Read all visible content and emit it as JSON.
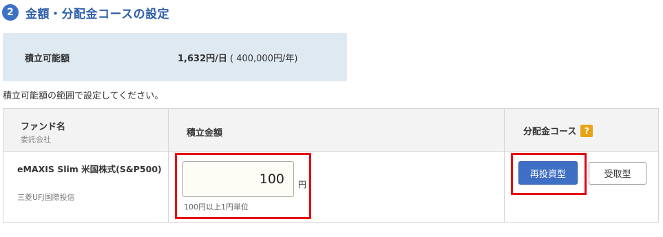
{
  "section": {
    "step_number": "2",
    "title": "金額・分配金コースの設定"
  },
  "limit": {
    "label": "積立可能額",
    "daily": "1,632円/日",
    "yearly": "( 400,000円/年)"
  },
  "note": "積立可能額の範囲で設定してください。",
  "table": {
    "headers": {
      "fund_name": "ファンド名",
      "fund_company": "委託会社",
      "amount": "積立金額",
      "course": "分配金コース",
      "help_icon": "?"
    },
    "row": {
      "fund_name": "eMAXIS Slim 米国株式(S&P500)",
      "fund_company": "三菱UFJ国際投信",
      "amount_value": "100",
      "amount_unit": "円",
      "amount_hint": "100円以上1円単位",
      "course_options": [
        "再投資型",
        "受取型"
      ],
      "course_selected": "再投資型"
    }
  },
  "colors": {
    "accent": "#2f5fa9",
    "badge": "#3a73c6",
    "limit_bg": "#dfe9f1",
    "highlight_frame": "#e60012",
    "selected_button": "#3f6fc4",
    "help_icon": "#e8a317"
  }
}
